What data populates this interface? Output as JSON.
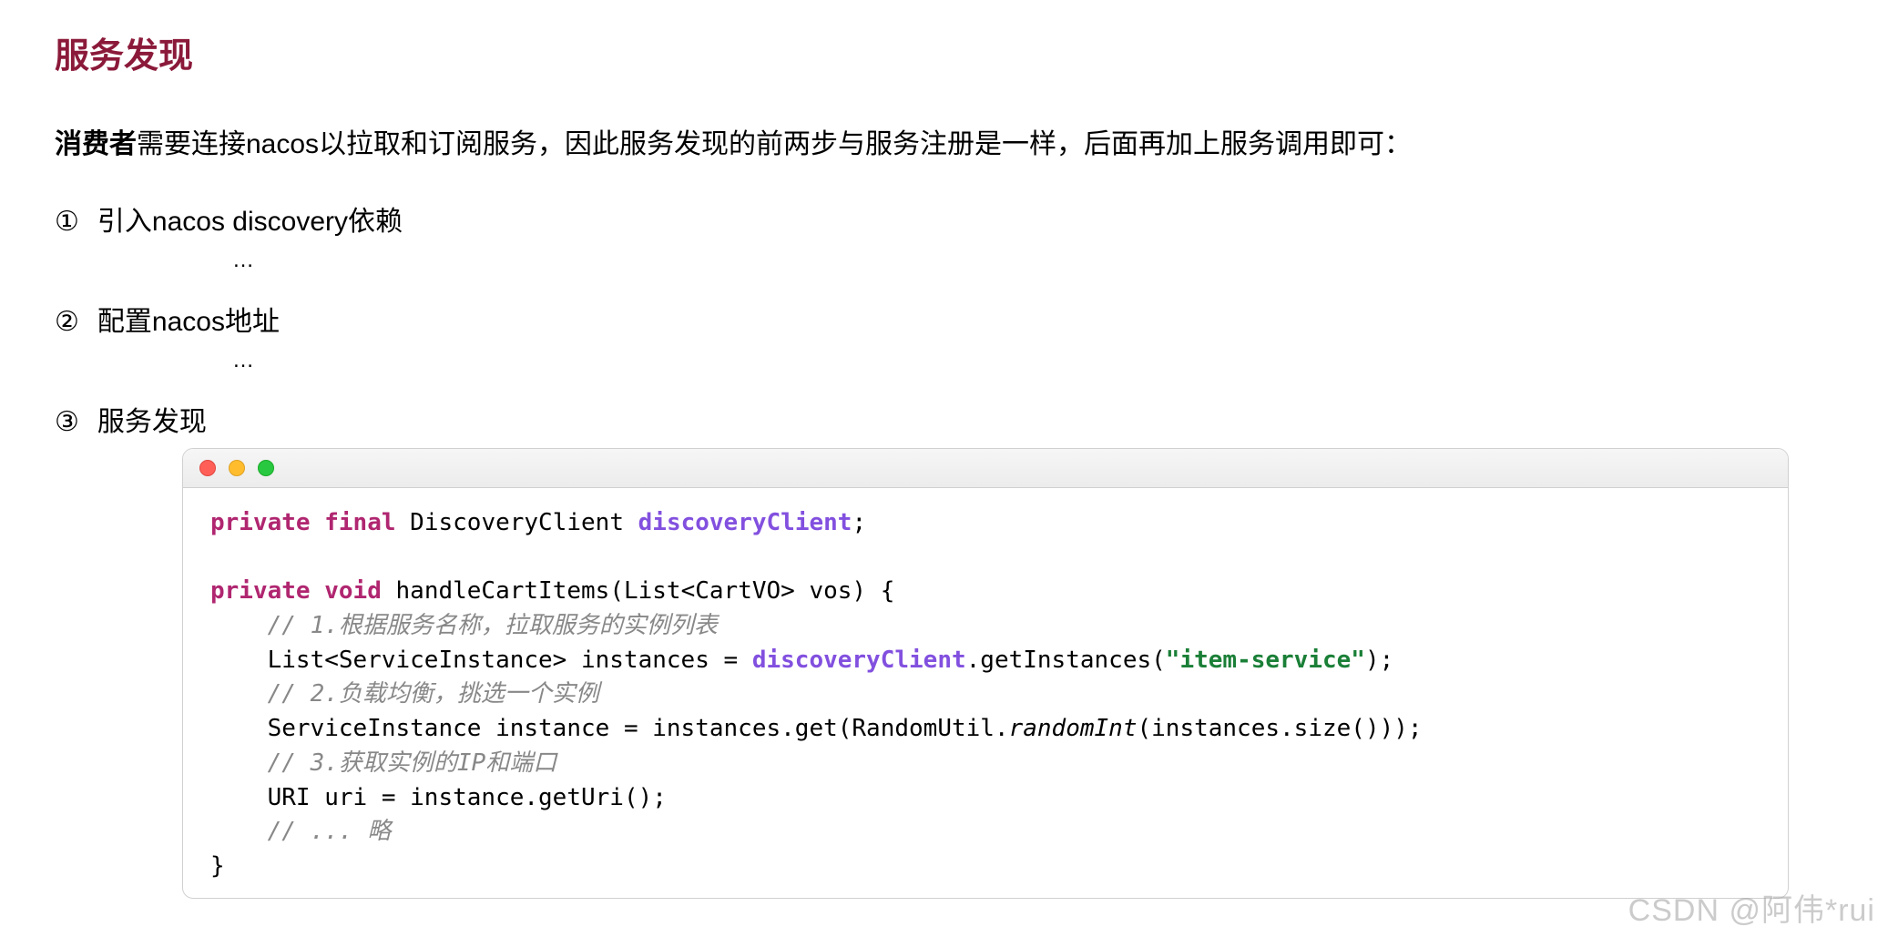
{
  "title": "服务发现",
  "intro_bold": "消费者",
  "intro_rest": "需要连接nacos以拉取和订阅服务，因此服务发现的前两步与服务注册是一样，后面再加上服务调用即可：",
  "steps": [
    {
      "num": "①",
      "text": "引入nacos discovery依赖"
    },
    {
      "num": "②",
      "text": "配置nacos地址"
    },
    {
      "num": "③",
      "text": "服务发现"
    }
  ],
  "ellipsis": "…",
  "code": {
    "line1_kw1": "private",
    "line1_kw2": "final",
    "line1_type": "DiscoveryClient",
    "line1_field": "discoveryClient",
    "line1_semi": ";",
    "line2_kw1": "private",
    "line2_kw2": "void",
    "line2_sig": "handleCartItems(List<CartVO> vos) {",
    "c1": "// 1.根据服务名称，拉取服务的实例列表",
    "line3_a": "    List<ServiceInstance> instances = ",
    "line3_field": "discoveryClient",
    "line3_b": ".getInstances(",
    "line3_str": "\"item-service\"",
    "line3_c": ");",
    "c2": "// 2.负载均衡，挑选一个实例",
    "line4_a": "    ServiceInstance instance = instances.get(RandomUtil.",
    "line4_m": "randomInt",
    "line4_b": "(instances.size()));",
    "c3": "// 3.获取实例的IP和端口",
    "line5": "    URI uri = instance.getUri();",
    "c4": "// ... 略",
    "line6": "}"
  },
  "watermark": "CSDN @阿伟*rui"
}
